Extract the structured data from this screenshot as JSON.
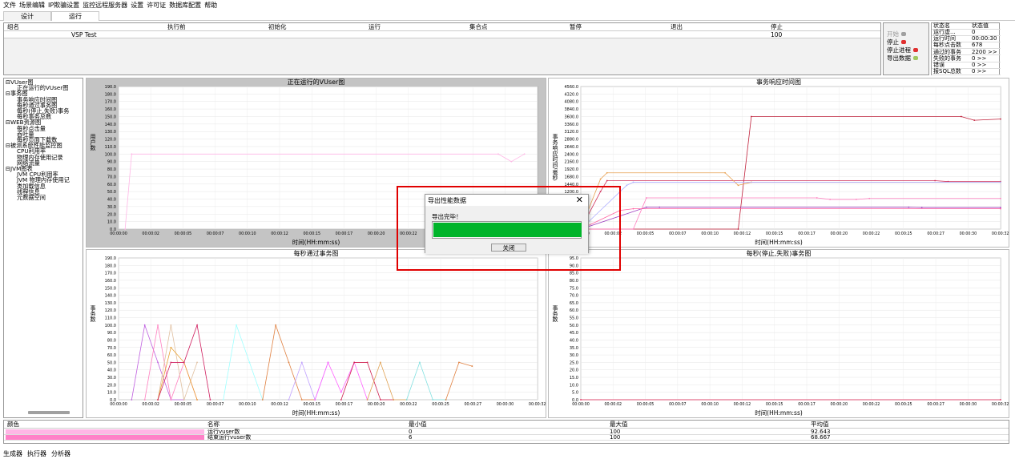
{
  "menu": [
    "文件",
    "场景编辑",
    "IP欺骗设置",
    "监控远程服务器",
    "设置",
    "许可证",
    "数据库配置",
    "帮助"
  ],
  "tabs": [
    "设计",
    "运行"
  ],
  "scenario_table": {
    "headers": [
      "组名",
      "执行前",
      "初始化",
      "运行",
      "集合点",
      "暂停",
      "退出",
      "停止"
    ],
    "row": {
      "group": "VSP Test",
      "stop": "100"
    }
  },
  "controls": [
    {
      "label": "开始",
      "color": "#a0a0a0",
      "disabled": true
    },
    {
      "label": "停止",
      "color": "#e03030"
    },
    {
      "label": "停止进程",
      "color": "#e03030"
    },
    {
      "label": "导出数据",
      "color": "#a0c860"
    }
  ],
  "status_table": {
    "headers": [
      "状态名",
      "状态值"
    ],
    "rows": [
      {
        "name": "运行虚...",
        "value": "0"
      },
      {
        "name": "运行时间",
        "value": "00:00:30"
      },
      {
        "name": "每秒点击数",
        "value": "678"
      },
      {
        "name": "通过的事务",
        "value": "2200 >>"
      },
      {
        "name": "失败的事务",
        "value": "0 >>"
      },
      {
        "name": "错误",
        "value": "0 >>"
      },
      {
        "name": "报SQL总数",
        "value": "0 >>"
      }
    ]
  },
  "tree": [
    {
      "label": "VUser图",
      "level": 0
    },
    {
      "label": "正在运行的VUser图",
      "level": 1
    },
    {
      "label": "事务图",
      "level": 0
    },
    {
      "label": "事务响应时间图",
      "level": 1
    },
    {
      "label": "每秒通过事务图",
      "level": 1
    },
    {
      "label": "每秒(停止,失败)事务",
      "level": 1
    },
    {
      "label": "每秒事务总数",
      "level": 1
    },
    {
      "label": "WEB资源图",
      "level": 0
    },
    {
      "label": "每秒点击量",
      "level": 1
    },
    {
      "label": "吞吐量",
      "level": 1
    },
    {
      "label": "每秒页面下载数",
      "level": 1
    },
    {
      "label": "被测系统性能监控图",
      "level": 0
    },
    {
      "label": "CPU利用率",
      "level": 1
    },
    {
      "label": "物理内存使用记录",
      "level": 1
    },
    {
      "label": "网络流量",
      "level": 1
    },
    {
      "label": "JVM图表",
      "level": 0
    },
    {
      "label": "JVM CPU利用率",
      "level": 1
    },
    {
      "label": "JVM 物理内存使用记",
      "level": 1
    },
    {
      "label": "类加载信息",
      "level": 1
    },
    {
      "label": "线程信息",
      "level": 1
    },
    {
      "label": "元数据空间",
      "level": 1
    }
  ],
  "x_ticks": [
    "00:00:00",
    "00:00:02",
    "00:00:05",
    "00:00:07",
    "00:00:10",
    "00:00:12",
    "00:00:15",
    "00:00:17",
    "00:00:20",
    "00:00:22",
    "00:00:25",
    "00:00:27",
    "00:00:30",
    "00:00:32"
  ],
  "chart_data": [
    {
      "type": "line",
      "title": "正在运行的VUser图",
      "xlabel": "时间(HH:mm:ss)",
      "ylabel": "用户数",
      "ylim": [
        0,
        190
      ],
      "yticks": [
        0,
        10,
        20,
        30,
        40,
        50,
        60,
        70,
        80,
        90,
        100,
        110,
        120,
        130,
        140,
        150,
        160,
        170,
        180,
        190
      ],
      "series": [
        {
          "color": "#ffb6e6",
          "x": [
            0.5,
            1,
            29,
            30,
            31
          ],
          "values": [
            0,
            100,
            100,
            90,
            100
          ]
        }
      ]
    },
    {
      "type": "line",
      "title": "事务响应时间图",
      "xlabel": "时间(HH:mm:ss)",
      "ylabel": "事务响应时间/毫秒",
      "ylim": [
        0,
        4560
      ],
      "yticks": [
        0,
        240,
        480,
        720,
        960,
        1200,
        1440,
        1680,
        1920,
        2160,
        2400,
        2640,
        2880,
        3120,
        3360,
        3600,
        3840,
        4080,
        4320,
        4560
      ],
      "series": [
        {
          "color": "#c0203a",
          "x": [
            0,
            12,
            13,
            29,
            30,
            32
          ],
          "values": [
            0,
            0,
            3600,
            3600,
            3480,
            3520
          ]
        },
        {
          "color": "#d0305a",
          "x": [
            0,
            1.5,
            2,
            27,
            28,
            32
          ],
          "values": [
            0,
            1200,
            1550,
            1550,
            1520,
            1520
          ]
        },
        {
          "color": "#e8a050",
          "x": [
            0,
            1.5,
            2,
            11,
            12,
            13,
            32
          ],
          "values": [
            0,
            1600,
            1800,
            1800,
            1400,
            1500,
            1500
          ]
        },
        {
          "color": "#a040c0",
          "x": [
            0,
            5,
            6,
            25,
            26,
            32
          ],
          "values": [
            0,
            700,
            700,
            700,
            690,
            690
          ]
        },
        {
          "color": "#ff80c0",
          "x": [
            0,
            4,
            5,
            18,
            19,
            21,
            22,
            32
          ],
          "values": [
            0,
            0,
            1000,
            1000,
            950,
            950,
            980,
            980
          ]
        },
        {
          "color": "#ff60a0",
          "x": [
            0,
            3,
            4,
            32
          ],
          "values": [
            0,
            600,
            650,
            650
          ]
        },
        {
          "color": "#b0b0ff",
          "x": [
            0,
            3.5,
            4,
            32
          ],
          "values": [
            0,
            1400,
            1500,
            1500
          ]
        }
      ]
    },
    {
      "type": "line",
      "title": "每秒通过事务图",
      "xlabel": "时间(HH:mm:ss)",
      "ylabel": "事务数",
      "ylim": [
        0,
        190
      ],
      "yticks": [
        0,
        10,
        20,
        30,
        40,
        50,
        60,
        70,
        80,
        90,
        100,
        110,
        120,
        130,
        140,
        150,
        160,
        170,
        180,
        190
      ],
      "series": [
        {
          "color": "#c060e0",
          "x": [
            1,
            2,
            3,
            4,
            5
          ],
          "values": [
            0,
            100,
            50,
            0,
            0
          ]
        },
        {
          "color": "#ff80c0",
          "x": [
            2,
            3,
            4,
            5,
            6
          ],
          "values": [
            0,
            100,
            0,
            50,
            0
          ]
        },
        {
          "color": "#e0c0a0",
          "x": [
            3,
            4,
            5,
            6
          ],
          "values": [
            0,
            100,
            0,
            50
          ]
        },
        {
          "color": "#e8a030",
          "x": [
            3,
            4,
            5,
            6
          ],
          "values": [
            0,
            70,
            50,
            0
          ]
        },
        {
          "color": "#d02060",
          "x": [
            3,
            4,
            5,
            6,
            7
          ],
          "values": [
            0,
            50,
            50,
            100,
            0
          ]
        },
        {
          "color": "#a0ffff",
          "x": [
            8,
            9,
            10,
            11
          ],
          "values": [
            0,
            100,
            50,
            0
          ]
        },
        {
          "color": "#e08040",
          "x": [
            11,
            12,
            13,
            14,
            15
          ],
          "values": [
            0,
            100,
            50,
            0,
            0
          ]
        },
        {
          "color": "#c0a0ff",
          "x": [
            13,
            14,
            15,
            16
          ],
          "values": [
            0,
            50,
            0,
            50
          ]
        },
        {
          "color": "#ff60ff",
          "x": [
            15,
            16,
            17,
            18,
            19
          ],
          "values": [
            0,
            50,
            10,
            50,
            0
          ]
        },
        {
          "color": "#d02050",
          "x": [
            17,
            18,
            19,
            20,
            21
          ],
          "values": [
            0,
            50,
            50,
            0,
            0
          ]
        },
        {
          "color": "#e0a050",
          "x": [
            19,
            20,
            21,
            22
          ],
          "values": [
            0,
            50,
            0,
            0
          ]
        },
        {
          "color": "#80e0e0",
          "x": [
            22,
            23,
            24,
            25
          ],
          "values": [
            0,
            50,
            0,
            0
          ]
        },
        {
          "color": "#e08040",
          "x": [
            25,
            26,
            27
          ],
          "values": [
            0,
            50,
            45
          ]
        }
      ]
    },
    {
      "type": "line",
      "title": "每秒(停止,失败)事务图",
      "xlabel": "时间(HH:mm:ss)",
      "ylabel": "事务数",
      "ylim": [
        0,
        95
      ],
      "yticks": [
        0,
        5,
        10,
        15,
        20,
        25,
        30,
        35,
        40,
        45,
        50,
        55,
        60,
        65,
        70,
        75,
        80,
        85,
        90,
        95
      ],
      "series": [
        {
          "color": "#e02050",
          "x": [
            0,
            32
          ],
          "values": [
            0,
            0
          ]
        }
      ]
    }
  ],
  "bottom_table": {
    "headers": [
      "颜色",
      "名称",
      "最小值",
      "最大值",
      "平均值"
    ],
    "rows": [
      {
        "color": "#ffb6e6",
        "name": "运行vuser数",
        "min": "0",
        "max": "100",
        "avg": "92.643"
      },
      {
        "color": "#ff80c8",
        "name": "结束运行vuser数",
        "min": "6",
        "max": "100",
        "avg": "68.667"
      }
    ]
  },
  "footer": [
    "生成器",
    "执行器",
    "分析器"
  ],
  "dialog": {
    "title": "导出性能数据",
    "message": "导出完毕！",
    "close_label": "关闭",
    "progress": 1.0
  }
}
